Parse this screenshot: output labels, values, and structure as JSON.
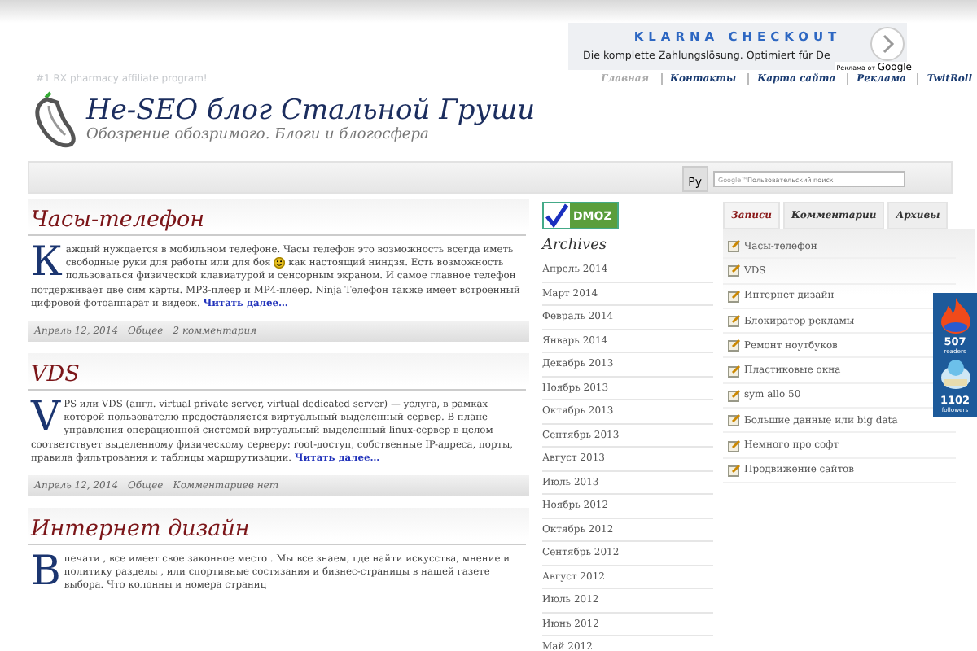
{
  "ad": {
    "title": "KLARNA CHECKOUT",
    "text": "Die komplette Zahlungslösung. Optimiert für De",
    "attribution": "Реклама от",
    "brand": "Google"
  },
  "tagline_top": "#1 RX pharmacy affiliate program!",
  "nav": [
    {
      "label": "Главная",
      "selected": true
    },
    {
      "label": "Контакты",
      "selected": false
    },
    {
      "label": "Карта сайта",
      "selected": false
    },
    {
      "label": "Реклама",
      "selected": false
    },
    {
      "label": "TwitRoll",
      "selected": false
    }
  ],
  "site": {
    "title": "Не-SEO блог Стальной Груши",
    "subtitle": "Обозрение обозримого. Блоги и блогосфера"
  },
  "toolbar": {
    "lang_button": "Ру",
    "search": {
      "brand": "Google™",
      "placeholder": "Пользовательский поиск"
    }
  },
  "posts": [
    {
      "title": "Часы-телефон",
      "drop_cap": "К",
      "text_before": "аждый нуждается в мобильном телефоне. Часы телефон это возможность всегда иметь свободные руки для работы или для боя",
      "smiley": true,
      "text_after": "как настоящий ниндзя. Есть возможность пользоваться физической клавиатурой и сенсорным экраном. И самое главное телефон потдерживает две сим карты. MP3-плеер и MP4-плеер. Ninja Телефон также имеет встроенный цифровой фотоаппарат и видеок.",
      "more": "Читать далее…",
      "date": "Апрель 12, 2014",
      "category": "Общее",
      "comments": "2 комментария"
    },
    {
      "title": "VDS",
      "drop_cap": "V",
      "text_before": "PS или VDS (англ. virtual private server, virtual dedicated server) — услуга, в рамках которой пользователю предоставляется виртуальный выделенный сервер. В плане управления операционной системой виртуальный выделенный linux-сервер в целом соответствует выделенному физическому серверу: root-доступ, собственные IP-адреса, порты, правила фильтрования и таблицы маршрутизации.",
      "more": "Читать далее…",
      "date": "Апрель 12, 2014",
      "category": "Общее",
      "comments": "Комментариев нет"
    },
    {
      "title": "Интернет дизайн",
      "drop_cap": "В",
      "text_before": "печати , все имеет свое законное место . Мы все знаем, где найти искусства, мнение и политику разделы , или спортивные состязания и бизнес-страницы в нашей газете выбора. Что колонны и номера страниц"
    }
  ],
  "dmoz": "DMOZ",
  "archives": {
    "title": "Archives",
    "items": [
      "Апрель 2014",
      "Март 2014",
      "Февраль 2014",
      "Январь 2014",
      "Декабрь 2013",
      "Ноябрь 2013",
      "Октябрь 2013",
      "Сентябрь 2013",
      "Август 2013",
      "Июль 2013",
      "Ноябрь 2012",
      "Октябрь 2012",
      "Сентябрь 2012",
      "Август 2012",
      "Июль 2012",
      "Июнь 2012",
      "Май 2012"
    ]
  },
  "tabs": [
    {
      "label": "Записи",
      "selected": true
    },
    {
      "label": "Комментарии",
      "selected": false
    },
    {
      "label": "Архивы",
      "selected": false
    }
  ],
  "recent": [
    "Часы-телефон",
    "VDS",
    "Интернет дизайн",
    "Блокиратор рекламы",
    "Ремонт ноутбуков",
    "Пластиковые окна",
    "sym allo 50",
    "Большие данные или big data",
    "Немного про софт",
    "Продвижение сайтов"
  ],
  "social": {
    "readers": "507",
    "readers_label": "readers",
    "followers": "1102",
    "followers_label": "followers"
  }
}
